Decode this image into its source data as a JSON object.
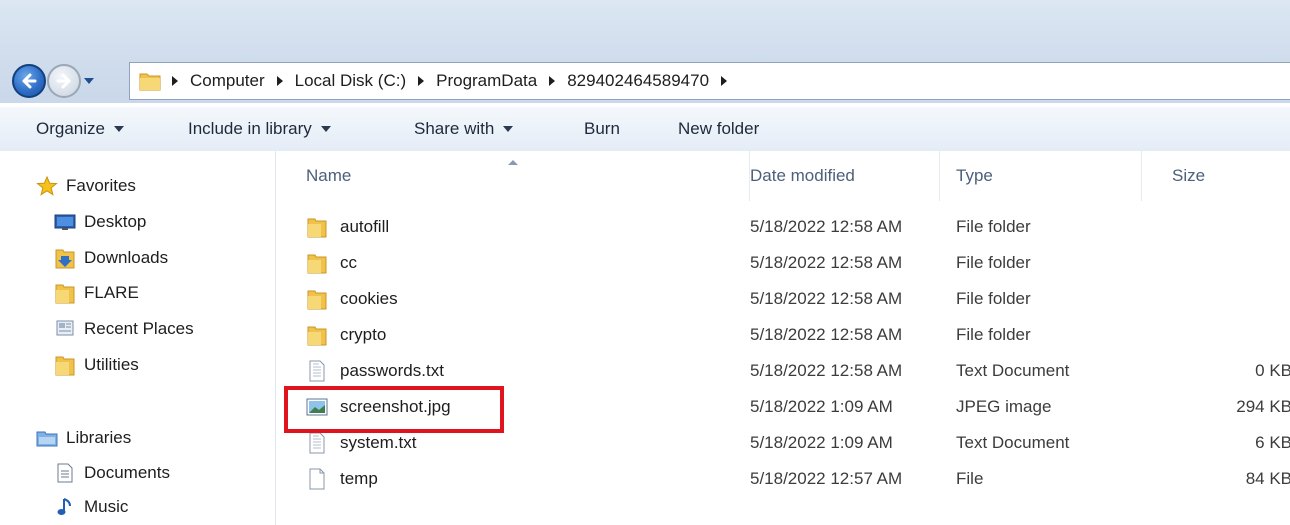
{
  "address": {
    "breadcrumb": [
      "Computer",
      "Local Disk (C:)",
      "ProgramData",
      "829402464589470"
    ]
  },
  "toolbar": {
    "organize": "Organize",
    "include_in_library": "Include in library",
    "share_with": "Share with",
    "burn": "Burn",
    "new_folder": "New folder"
  },
  "nav": {
    "favorites": "Favorites",
    "desktop": "Desktop",
    "downloads": "Downloads",
    "flare": "FLARE",
    "recent_places": "Recent Places",
    "utilities": "Utilities",
    "libraries": "Libraries",
    "documents": "Documents",
    "music": "Music"
  },
  "columns": {
    "name": "Name",
    "date_modified": "Date modified",
    "type": "Type",
    "size": "Size"
  },
  "files": [
    {
      "name": "autofill",
      "date": "5/18/2022 12:58 AM",
      "type": "File folder",
      "size": "",
      "icon": "folder-icon"
    },
    {
      "name": "cc",
      "date": "5/18/2022 12:58 AM",
      "type": "File folder",
      "size": "",
      "icon": "folder-icon"
    },
    {
      "name": "cookies",
      "date": "5/18/2022 12:58 AM",
      "type": "File folder",
      "size": "",
      "icon": "folder-icon"
    },
    {
      "name": "crypto",
      "date": "5/18/2022 12:58 AM",
      "type": "File folder",
      "size": "",
      "icon": "folder-icon"
    },
    {
      "name": "passwords.txt",
      "date": "5/18/2022 12:58 AM",
      "type": "Text Document",
      "size": "0 KB",
      "icon": "text-file-icon"
    },
    {
      "name": "screenshot.jpg",
      "date": "5/18/2022 1:09 AM",
      "type": "JPEG image",
      "size": "294 KB",
      "icon": "image-file-icon"
    },
    {
      "name": "system.txt",
      "date": "5/18/2022 1:09 AM",
      "type": "Text Document",
      "size": "6 KB",
      "icon": "text-file-icon"
    },
    {
      "name": "temp",
      "date": "5/18/2022 12:57 AM",
      "type": "File",
      "size": "84 KB",
      "icon": "blank-file-icon"
    }
  ],
  "colors": {
    "highlight": "#e0141e",
    "folder": "#e8b93a"
  }
}
